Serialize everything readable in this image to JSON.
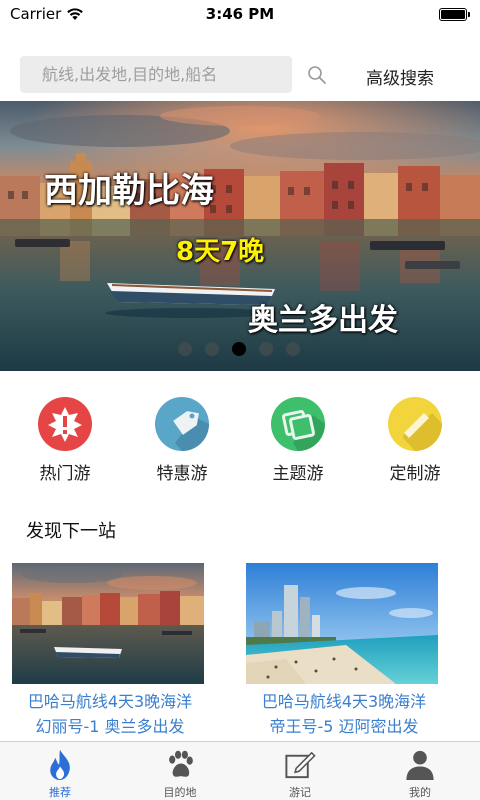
{
  "status_bar": {
    "carrier": "Carrier",
    "time": "3:46 PM"
  },
  "search": {
    "placeholder": "航线,出发地,目的地,船名",
    "advanced_label": "高级搜索"
  },
  "banner": {
    "title": "西加勒比海",
    "duration": "8天7晚",
    "departure": "奥兰多出发",
    "page_count": 5,
    "active_index": 2
  },
  "categories": [
    {
      "label": "热门游",
      "icon": "hot-icon",
      "color": "#e64545"
    },
    {
      "label": "特惠游",
      "icon": "tag-icon",
      "color": "#5aa6c8"
    },
    {
      "label": "主题游",
      "icon": "photo-icon",
      "color": "#3dbf6b"
    },
    {
      "label": "定制游",
      "icon": "pencil-icon",
      "color": "#f2d53c"
    }
  ],
  "section": {
    "title": "发现下一站"
  },
  "cards": [
    {
      "line1": "巴哈马航线4天3晚海洋",
      "line2": "幻丽号-1 奥兰多出发"
    },
    {
      "line1": "巴哈马航线4天3晚海洋",
      "line2": "帝王号-5 迈阿密出发"
    }
  ],
  "tabs": [
    {
      "label": "推荐",
      "icon": "flame-icon",
      "active": true
    },
    {
      "label": "目的地",
      "icon": "paw-icon",
      "active": false
    },
    {
      "label": "游记",
      "icon": "note-edit-icon",
      "active": false
    },
    {
      "label": "我的",
      "icon": "user-icon",
      "active": false
    }
  ],
  "colors": {
    "accent": "#2b6fd6",
    "card_title": "#3a7fd0",
    "highlight": "#fff200"
  }
}
